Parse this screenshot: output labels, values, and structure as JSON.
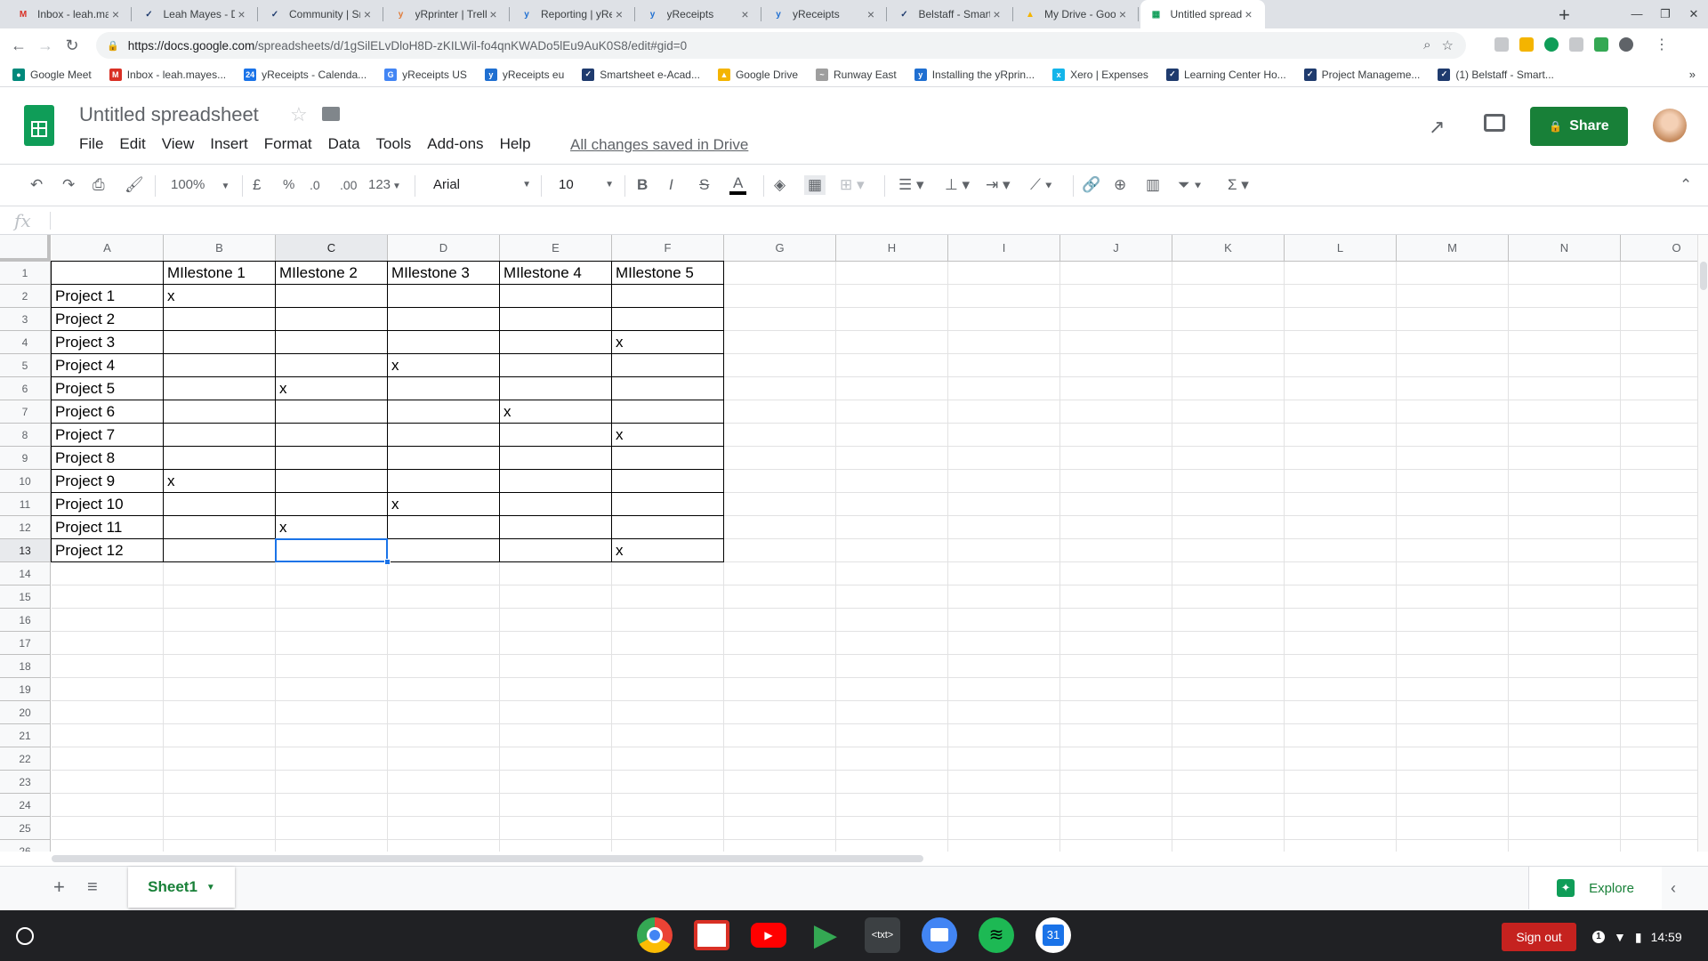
{
  "browser": {
    "tabs": [
      {
        "title": "Inbox - leah.mayes@",
        "favicon": "gmail-icon",
        "color": "#d93025",
        "glyph": "M"
      },
      {
        "title": "Leah Mayes - Data V",
        "favicon": "smartsheet-icon",
        "color": "#1f3b6e",
        "glyph": "✓"
      },
      {
        "title": "Community | Smarts",
        "favicon": "smartsheet-icon",
        "color": "#1f3b6e",
        "glyph": "✓"
      },
      {
        "title": "yRprinter | Trello",
        "favicon": "trello-icon",
        "color": "#e07b39",
        "glyph": "y"
      },
      {
        "title": "Reporting | yReceipt",
        "favicon": "yreceipts-icon",
        "color": "#1f6fd1",
        "glyph": "y"
      },
      {
        "title": "yReceipts",
        "favicon": "yreceipts-icon",
        "color": "#1f6fd1",
        "glyph": "y"
      },
      {
        "title": "yReceipts",
        "favicon": "yreceipts-icon",
        "color": "#1f6fd1",
        "glyph": "y"
      },
      {
        "title": "Belstaff - Smartshee",
        "favicon": "smartsheet-icon",
        "color": "#1f3b6e",
        "glyph": "✓"
      },
      {
        "title": "My Drive - Google Dr",
        "favicon": "google-drive-icon",
        "color": "#f4b400",
        "glyph": "▲"
      },
      {
        "title": "Untitled spreadshee",
        "favicon": "sheets-icon",
        "color": "#0f9d58",
        "glyph": "▦"
      }
    ],
    "new_tab": "+",
    "url_host": "https://docs.google.com",
    "url_path": "/spreadsheets/d/1gSilELvDloH8D-zKILWil-fo4qnKWADo5lEu9AuK0S8/edit#gid=0",
    "bookmarks": [
      {
        "label": "Google Meet",
        "favicon": "meet-icon",
        "color": "#00897b",
        "glyph": "●"
      },
      {
        "label": "Inbox - leah.mayes...",
        "favicon": "gmail-icon",
        "color": "#d93025",
        "glyph": "M"
      },
      {
        "label": "yReceipts - Calenda...",
        "favicon": "calendar-icon",
        "color": "#1a73e8",
        "glyph": "24"
      },
      {
        "label": "yReceipts US",
        "favicon": "google-icon",
        "color": "#4285f4",
        "glyph": "G"
      },
      {
        "label": "yReceipts eu",
        "favicon": "yreceipts-icon",
        "color": "#1f6fd1",
        "glyph": "y"
      },
      {
        "label": "Smartsheet e-Acad...",
        "favicon": "smartsheet-icon",
        "color": "#1f3b6e",
        "glyph": "✓"
      },
      {
        "label": "Google Drive",
        "favicon": "google-drive-icon",
        "color": "#f4b400",
        "glyph": "▲"
      },
      {
        "label": "Runway East",
        "favicon": "runway-east-icon",
        "color": "#9e9e9e",
        "glyph": "~"
      },
      {
        "label": "Installing the yRprin...",
        "favicon": "yreceipts-icon",
        "color": "#1f6fd1",
        "glyph": "y"
      },
      {
        "label": "Xero | Expenses",
        "favicon": "xero-icon",
        "color": "#13b5ea",
        "glyph": "x"
      },
      {
        "label": "Learning Center Ho...",
        "favicon": "smartsheet-icon",
        "color": "#1f3b6e",
        "glyph": "✓"
      },
      {
        "label": "Project Manageme...",
        "favicon": "smartsheet-icon",
        "color": "#1f3b6e",
        "glyph": "✓"
      },
      {
        "label": "(1) Belstaff - Smart...",
        "favicon": "smartsheet-icon",
        "color": "#1f3b6e",
        "glyph": "✓"
      }
    ],
    "bookmarks_more": "»"
  },
  "docs": {
    "title": "Untitled spreadsheet",
    "menu": [
      "File",
      "Edit",
      "View",
      "Insert",
      "Format",
      "Data",
      "Tools",
      "Add-ons",
      "Help"
    ],
    "saved_status": "All changes saved in Drive",
    "share_label": "Share",
    "brand_color": "#0f9d58"
  },
  "toolbar": {
    "zoom": "100%",
    "currency": "£",
    "percent": "%",
    "decrease_decimal": ".0",
    "increase_decimal": ".00",
    "more_formats": "123",
    "font": "Arial",
    "font_size": "10",
    "bold": "B",
    "italic": "I",
    "strike": "S",
    "text_color": "A"
  },
  "formula_bar": {
    "fx": "fx",
    "value": ""
  },
  "grid": {
    "columns": [
      "A",
      "B",
      "C",
      "D",
      "E",
      "F",
      "G",
      "H",
      "I",
      "J",
      "K",
      "L",
      "M",
      "N",
      "O"
    ],
    "row_numbers": [
      "1",
      "2",
      "3",
      "4",
      "5",
      "6",
      "7",
      "8",
      "9",
      "10",
      "11",
      "12",
      "13",
      "14",
      "15",
      "16",
      "17",
      "18",
      "19",
      "20",
      "21",
      "22",
      "23",
      "24",
      "25",
      "26"
    ],
    "selected_cell": "C13",
    "rows": [
      [
        "",
        "MIlestone 1",
        "MIlestone 2",
        "MIlestone 3",
        "MIlestone 4",
        "MIlestone 5"
      ],
      [
        "Project 1",
        "x",
        "",
        "",
        "",
        ""
      ],
      [
        "Project 2",
        "",
        "",
        "",
        "",
        ""
      ],
      [
        "Project 3",
        "",
        "",
        "",
        "",
        "x"
      ],
      [
        "Project 4",
        "",
        "",
        "x",
        "",
        ""
      ],
      [
        "Project 5",
        "",
        "x",
        "",
        "",
        ""
      ],
      [
        "Project 6",
        "",
        "",
        "",
        "x",
        ""
      ],
      [
        "Project 7",
        "",
        "",
        "",
        "",
        "x"
      ],
      [
        "Project 8",
        "",
        "",
        "",
        "",
        ""
      ],
      [
        "Project 9",
        "x",
        "",
        "",
        "",
        ""
      ],
      [
        "Project 10",
        "",
        "",
        "x",
        "",
        ""
      ],
      [
        "Project 11",
        "",
        "x",
        "",
        "",
        ""
      ],
      [
        "Project 12",
        "",
        "",
        "",
        "",
        "x"
      ]
    ]
  },
  "sheets": {
    "tabs": [
      "Sheet1"
    ],
    "explore_label": "Explore"
  },
  "shelf": {
    "apps": [
      {
        "name": "chrome-icon",
        "color": "#4285f4"
      },
      {
        "name": "gmail-icon",
        "color": "#ffffff"
      },
      {
        "name": "youtube-icon",
        "color": "#ff0000"
      },
      {
        "name": "play-store-icon",
        "color": "#ffffff"
      },
      {
        "name": "text-editor-icon",
        "color": "#3c4043"
      },
      {
        "name": "files-icon",
        "color": "#4285f4"
      },
      {
        "name": "spotify-icon",
        "color": "#1db954"
      },
      {
        "name": "calendar-icon",
        "color": "#1a73e8"
      }
    ],
    "text_app_label": "<txt>",
    "calendar_day": "31",
    "sign_out": "Sign out",
    "notification_count": "1",
    "time": "14:59"
  }
}
